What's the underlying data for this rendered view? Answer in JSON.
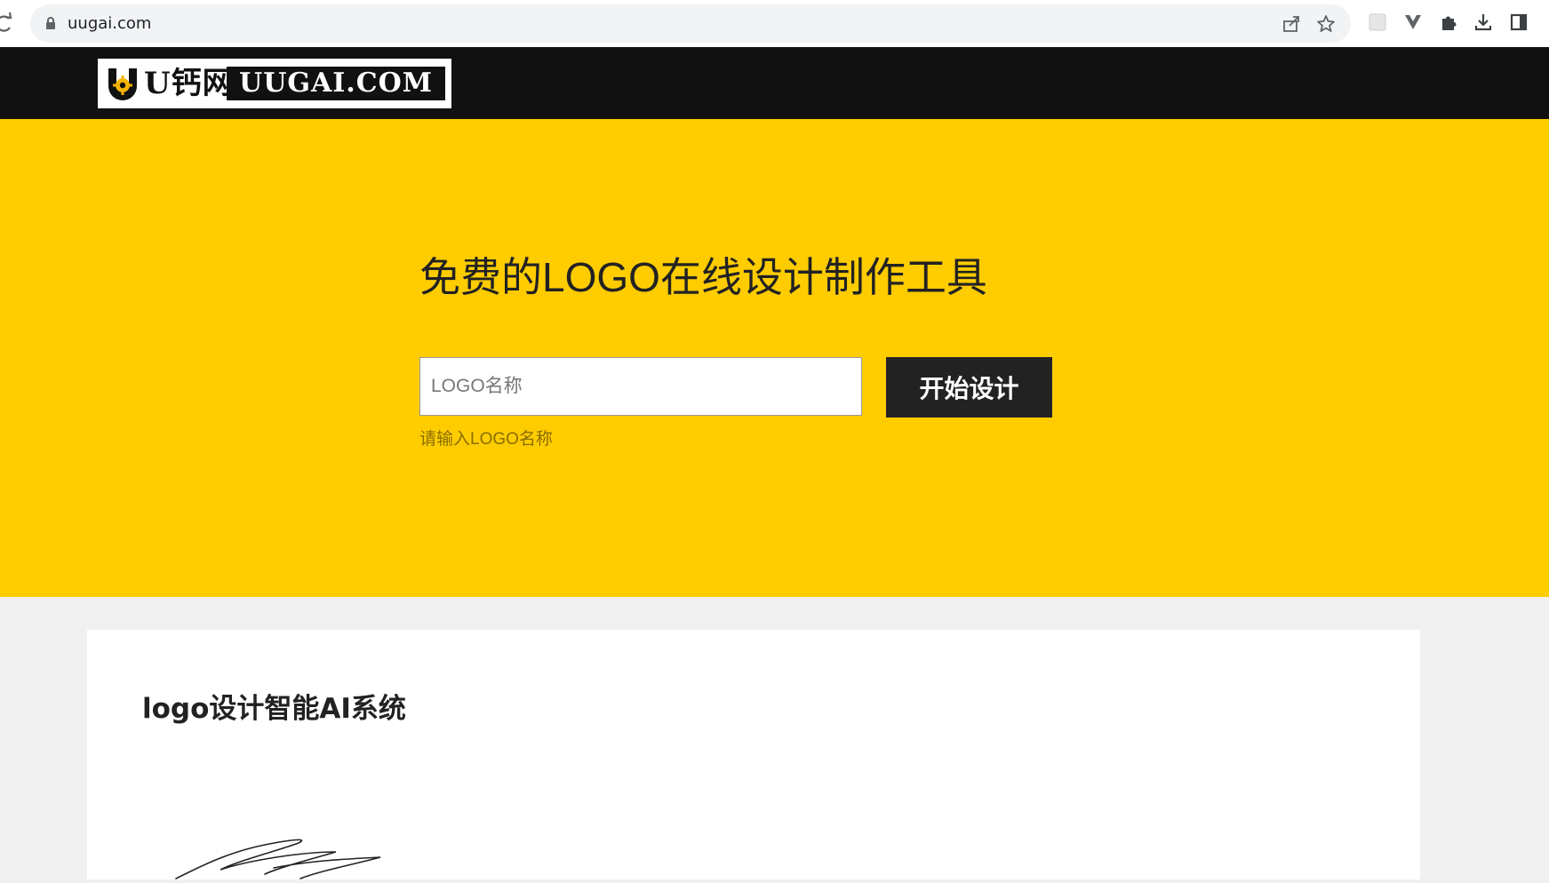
{
  "browser": {
    "url": "uugai.com",
    "icons": [
      "reload-icon",
      "lock-icon",
      "share-icon",
      "star-icon",
      "extension-tile-icon",
      "vue-icon",
      "puzzle-icon",
      "download-icon",
      "sidepanel-icon"
    ]
  },
  "header": {
    "logo_cn": "U钙网",
    "logo_en": "UUGAI.COM"
  },
  "hero": {
    "title": "免费的LOGO在线设计制作工具",
    "input_placeholder": "LOGO名称",
    "input_value": "",
    "hint": "请输入LOGO名称",
    "start_button": "开始设计"
  },
  "section": {
    "title": "logo设计智能AI系统"
  },
  "colors": {
    "hero_bg": "#ffcc00",
    "header_bg": "#111111",
    "button_bg": "#222222",
    "page_bg": "#f0f0f0"
  }
}
